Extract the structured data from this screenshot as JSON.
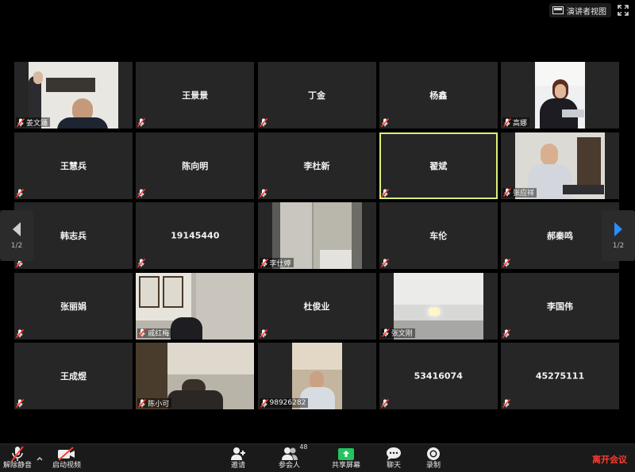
{
  "topbar": {
    "view_label": "演讲者视图"
  },
  "nav": {
    "left_page": "1/2",
    "right_page": "1/2"
  },
  "tiles": [
    {
      "name": "姜文踊",
      "video": true,
      "name_pos": "label"
    },
    {
      "name": "王景景",
      "video": false
    },
    {
      "name": "丁金",
      "video": false
    },
    {
      "name": "杨鑫",
      "video": false
    },
    {
      "name": "高娜",
      "video": true,
      "name_pos": "label"
    },
    {
      "name": "王慧兵",
      "video": false
    },
    {
      "name": "陈向明",
      "video": false
    },
    {
      "name": "李杜新",
      "video": false
    },
    {
      "name": "翟斌",
      "video": false,
      "active": true
    },
    {
      "name": "张应祥",
      "video": true,
      "name_pos": "label"
    },
    {
      "name": "韩志兵",
      "video": false
    },
    {
      "name": "19145440",
      "video": false
    },
    {
      "name": "李仕婷",
      "video": true,
      "name_pos": "label"
    },
    {
      "name": "车伦",
      "video": false
    },
    {
      "name": "郝秦鸣",
      "video": false
    },
    {
      "name": "张丽娟",
      "video": false
    },
    {
      "name": "戚红梅",
      "video": true,
      "name_pos": "label"
    },
    {
      "name": "杜俊业",
      "video": false
    },
    {
      "name": "张文刚",
      "video": true,
      "name_pos": "label"
    },
    {
      "name": "李国伟",
      "video": false
    },
    {
      "name": "王成煜",
      "video": false
    },
    {
      "name": "陈小可",
      "video": true,
      "name_pos": "label"
    },
    {
      "name": "98926282",
      "video": true,
      "name_pos": "label"
    },
    {
      "name": "53416074",
      "video": false
    },
    {
      "name": "45275111",
      "video": false
    }
  ],
  "toolbar": {
    "unmute": "解除静音",
    "start_video": "启动视频",
    "invite": "邀请",
    "participants": "参会人",
    "participant_count": "48",
    "share": "共享屏幕",
    "chat": "聊天",
    "record": "录制",
    "leave": "离开会议"
  },
  "colors": {
    "accent_green": "#22c55e",
    "leave_red": "#ff3b30",
    "active_outline": "#d9f07a",
    "nav_blue": "#2d8cff"
  }
}
